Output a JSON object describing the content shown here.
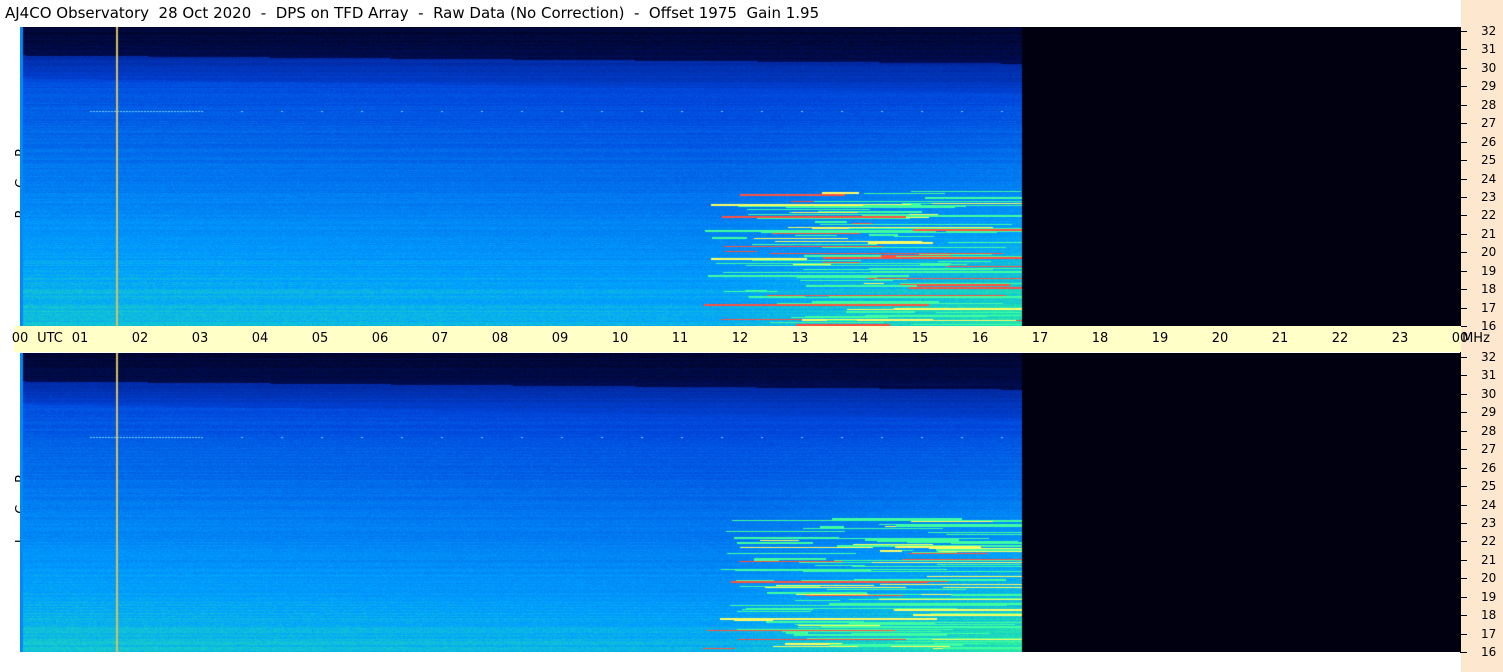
{
  "title": "AJ4CO Observatory  28 Oct 2020  -  DPS on TFD Array  -  Raw Data (No Correction)  -  Offset 1975  Gain 1.95",
  "panels": {
    "top_label": "RCP",
    "bottom_label": "LCP"
  },
  "time_axis": {
    "ticks": [
      "00",
      "01",
      "02",
      "03",
      "04",
      "05",
      "06",
      "07",
      "08",
      "09",
      "10",
      "11",
      "12",
      "13",
      "14",
      "15",
      "16",
      "17",
      "18",
      "19",
      "20",
      "21",
      "22",
      "23",
      "00"
    ],
    "unit": "UTC",
    "freq_unit": "MHz"
  },
  "freq_axis": {
    "ticks": [
      "32",
      "31",
      "30",
      "29",
      "28",
      "27",
      "26",
      "25",
      "24",
      "23",
      "22",
      "21",
      "20",
      "19",
      "18",
      "17",
      "16"
    ]
  },
  "chart_data": {
    "type": "heatmap",
    "title": "AJ4CO Observatory  28 Oct 2020  -  DPS on TFD Array  -  Raw Data (No Correction)  -  Offset 1975  Gain 1.95",
    "xlabel": "UTC",
    "ylabel": "MHz",
    "xlim": [
      0,
      24
    ],
    "ylim": [
      16,
      32
    ],
    "series": [
      {
        "name": "RCP",
        "data_end_hour": 16.7
      },
      {
        "name": "LCP",
        "data_end_hour": 16.7
      }
    ],
    "colormap": [
      "#000010",
      "#001f8a",
      "#0050e0",
      "#00a8ff",
      "#3cff8c",
      "#ffff40",
      "#ff4020"
    ],
    "marker_line_hour": 1.6
  }
}
